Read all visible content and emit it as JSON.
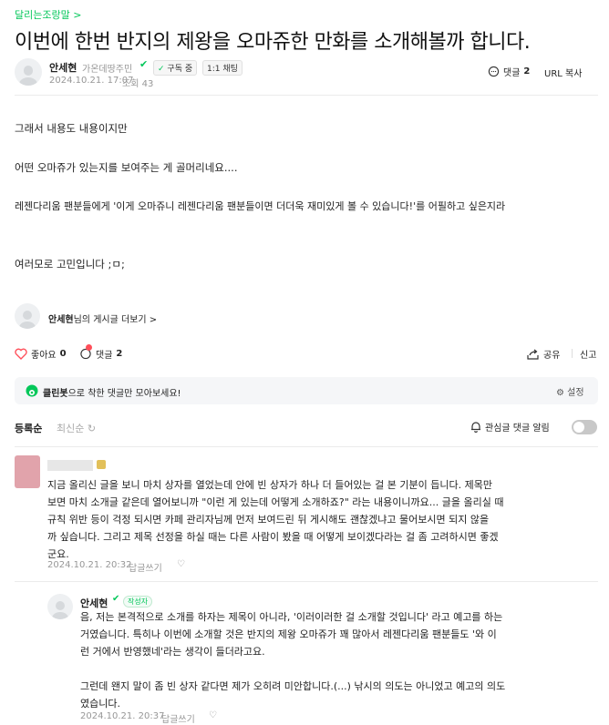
{
  "board": {
    "name": "달리는조랑말 >"
  },
  "post": {
    "title": "이번에 한번 반지의 제왕을 오마쥬한 만화를 소개해볼까 합니다.",
    "author": "안세현",
    "level": "가온데땅주민",
    "subscribe_label": "구독 중",
    "chat_label": "1:1 채팅",
    "date": "2024.10.21. 17:07",
    "views": "조회 43",
    "comment_label": "댓글",
    "comment_count": "2",
    "url_copy": "URL 복사",
    "body": [
      "그래서 내용도 내용이지만",
      "어떤 오마쥬가 있는지를 보여주는 게 골머리네요....",
      "레젠다리움 팬분들에게 '이게 오마쥬니 레젠다리움 팬분들이면 더더욱 재미있게 볼 수 있습니다!'를 어필하고 싶은지라",
      "여러모로 고민입니다 ;ㅁ;"
    ],
    "more_posts": "님의 게시글 더보기 >",
    "like_label": "좋아요",
    "like_count": "0",
    "share_label": "공유",
    "report_label": "신고"
  },
  "cleanbot": {
    "brand": "클린봇",
    "text": "으로 착한 댓글만 모아보세요!",
    "settings": "설정"
  },
  "comments_bar": {
    "sort_registered": "등록순",
    "sort_latest": "최신순",
    "notify_label": "관심글 댓글 알림"
  },
  "comments": [
    {
      "lines": [
        "지금 올리신 글을 보니 마치 상자를 열었는데 안에 빈 상자가 하나 더 들어있는 걸 본 기분이 듭니다. 제목만",
        "보면 마치 소개글 같은데 열어보니까 \"이런 게 있는데 어떻게 소개하죠?\" 라는 내용이니까요... 글을 올리실 때",
        "규칙 위반 등이 걱정 되시면 카페 관리자님께 먼저 보여드린 뒤 게시해도 괜찮겠냐고 물어보시면 되지 않을",
        "까 싶습니다. 그리고 제목 선정을 하실 때는 다른 사람이 봤을 때 어떻게 보이겠다라는 걸 좀 고려하시면 좋겠",
        "군요."
      ],
      "date": "2024.10.21. 20:32",
      "reply": "답글쓰기"
    },
    {
      "author": "안세현",
      "writer_badge": "작성자",
      "lines": [
        "음, 저는 본격적으로 소개를 하자는 제목이 아니라, '이러이러한 걸 소개할 것입니다' 라고 예고를 하는",
        "거였습니다. 특히나 이번에 소개할 것은 반지의 제왕 오마쥬가 꽤 많아서 레젠다리움 팬분들도 '와 이",
        "런 거에서 반영했네'라는 생각이 들더라고요.",
        "",
        "그런데 왠지 말이 좀 빈 상자 같다면 제가 오히려 미안합니다.(...) 낚시의 의도는 아니었고 예고의 의도",
        "였습니다."
      ],
      "date": "2024.10.21. 20:37",
      "reply": "답글쓰기"
    }
  ],
  "colors": {
    "accent": "#03c75a",
    "like": "#ff4e59",
    "text": "#222222",
    "muted": "#979797"
  }
}
